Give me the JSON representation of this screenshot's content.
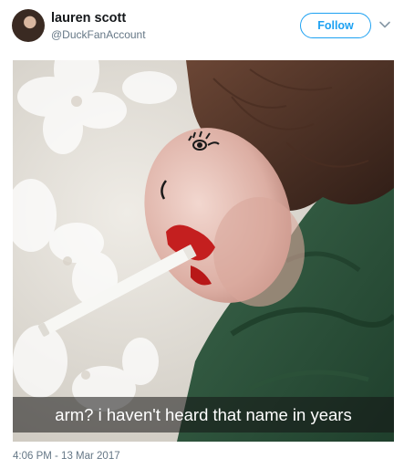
{
  "tweet": {
    "author": {
      "display_name": "lauren scott",
      "handle": "@DuckFanAccount"
    },
    "follow_label": "Follow",
    "menu_icon": "chevron-down-icon",
    "photo": {
      "caption": "arm? i haven't heard that name in years"
    },
    "timestamp": "4:06 PM - 13 Mar 2017"
  },
  "colors": {
    "accent": "#1da1f2",
    "secondary_text": "#657786",
    "primary_text": "#14171a"
  }
}
